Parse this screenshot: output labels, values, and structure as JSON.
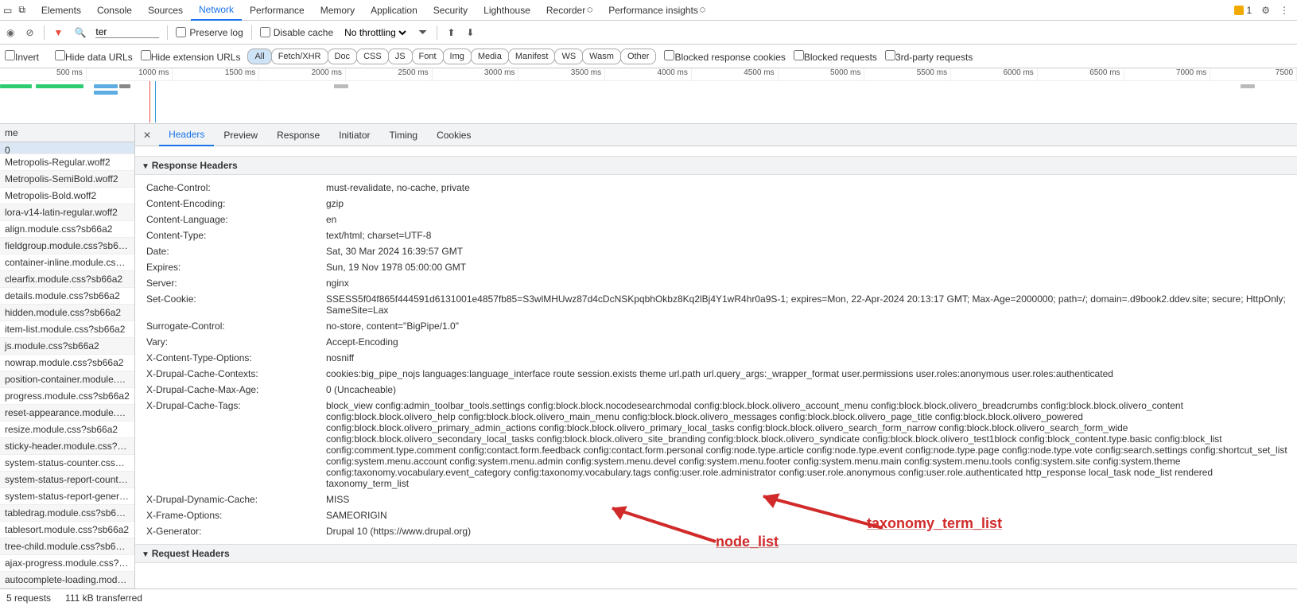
{
  "top_tabs": {
    "items": [
      "Elements",
      "Console",
      "Sources",
      "Network",
      "Performance",
      "Memory",
      "Application",
      "Security",
      "Lighthouse",
      "Recorder",
      "Performance insights"
    ],
    "active_index": 3,
    "beta_indices": [
      9,
      10
    ],
    "warnings": "1"
  },
  "toolbar": {
    "preserve_log": "Preserve log",
    "disable_cache": "Disable cache",
    "throttling": "No throttling",
    "filter_placeholder": "ter"
  },
  "filters2": {
    "invert": "Invert",
    "hide_data": "Hide data URLs",
    "hide_ext": "Hide extension URLs",
    "types": [
      "All",
      "Fetch/XHR",
      "Doc",
      "CSS",
      "JS",
      "Font",
      "Img",
      "Media",
      "Manifest",
      "WS",
      "Wasm",
      "Other"
    ],
    "active_type": 0,
    "blocked_cookies": "Blocked response cookies",
    "blocked_requests": "Blocked requests",
    "third_party": "3rd-party requests"
  },
  "timeline_ticks": [
    "500 ms",
    "1000 ms",
    "1500 ms",
    "2000 ms",
    "2500 ms",
    "3000 ms",
    "3500 ms",
    "4000 ms",
    "4500 ms",
    "5000 ms",
    "5500 ms",
    "6000 ms",
    "6500 ms",
    "7000 ms",
    "7500"
  ],
  "left": {
    "head": "me",
    "selected": "0",
    "rows": [
      "Metropolis-Regular.woff2",
      "Metropolis-SemiBold.woff2",
      "Metropolis-Bold.woff2",
      "lora-v14-latin-regular.woff2",
      "align.module.css?sb66a2",
      "fieldgroup.module.css?sb66…",
      "container-inline.module.css?…",
      "clearfix.module.css?sb66a2",
      "details.module.css?sb66a2",
      "hidden.module.css?sb66a2",
      "item-list.module.css?sb66a2",
      "js.module.css?sb66a2",
      "nowrap.module.css?sb66a2",
      "position-container.module.c…",
      "progress.module.css?sb66a2",
      "reset-appearance.module.cs…",
      "resize.module.css?sb66a2",
      "sticky-header.module.css?s…",
      "system-status-counter.css?…",
      "system-status-report-count…",
      "system-status-report-gener…",
      "tabledrag.module.css?sb66a2",
      "tablesort.module.css?sb66a2",
      "tree-child.module.css?sb66…",
      "ajax-progress.module.css?s…",
      "autocomplete-loading.modu…"
    ]
  },
  "subtabs": {
    "items": [
      "Headers",
      "Preview",
      "Response",
      "Initiator",
      "Timing",
      "Cookies"
    ],
    "active_index": 0
  },
  "response_headers_title": "Response Headers",
  "request_headers_title": "Request Headers",
  "headers": [
    {
      "k": "Cache-Control:",
      "v": "must-revalidate, no-cache, private"
    },
    {
      "k": "Content-Encoding:",
      "v": "gzip"
    },
    {
      "k": "Content-Language:",
      "v": "en"
    },
    {
      "k": "Content-Type:",
      "v": "text/html; charset=UTF-8"
    },
    {
      "k": "Date:",
      "v": "Sat, 30 Mar 2024 16:39:57 GMT"
    },
    {
      "k": "Expires:",
      "v": "Sun, 19 Nov 1978 05:00:00 GMT"
    },
    {
      "k": "Server:",
      "v": "nginx"
    },
    {
      "k": "Set-Cookie:",
      "v": "SSESS5f04f865f444591d6131001e4857fb85=S3wlMHUwz87d4cDcNSKpqbhOkbz8Kq2lBj4Y1wR4hr0a9S-1; expires=Mon, 22-Apr-2024 20:13:17 GMT; Max-Age=2000000; path=/; domain=.d9book2.ddev.site; secure; HttpOnly; SameSite=Lax"
    },
    {
      "k": "Surrogate-Control:",
      "v": "no-store, content=\"BigPipe/1.0\""
    },
    {
      "k": "Vary:",
      "v": "Accept-Encoding"
    },
    {
      "k": "X-Content-Type-Options:",
      "v": "nosniff"
    },
    {
      "k": "X-Drupal-Cache-Contexts:",
      "v": "cookies:big_pipe_nojs languages:language_interface route session.exists theme url.path url.query_args:_wrapper_format user.permissions user.roles:anonymous user.roles:authenticated"
    },
    {
      "k": "X-Drupal-Cache-Max-Age:",
      "v": "0 (Uncacheable)"
    },
    {
      "k": "X-Drupal-Cache-Tags:",
      "v": "block_view config:admin_toolbar_tools.settings config:block.block.nocodesearchmodal config:block.block.olivero_account_menu config:block.block.olivero_breadcrumbs config:block.block.olivero_content config:block.block.olivero_help config:block.block.olivero_main_menu config:block.block.olivero_messages config:block.block.olivero_page_title config:block.block.olivero_powered config:block.block.olivero_primary_admin_actions config:block.block.olivero_primary_local_tasks config:block.block.olivero_search_form_narrow config:block.block.olivero_search_form_wide config:block.block.olivero_secondary_local_tasks config:block.block.olivero_site_branding config:block.block.olivero_syndicate config:block.block.olivero_test1block config:block_content.type.basic config:block_list config:comment.type.comment config:contact.form.feedback config:contact.form.personal config:node.type.article config:node.type.event config:node.type.page config:node.type.vote config:search.settings config:shortcut_set_list config:system.menu.account config:system.menu.admin config:system.menu.devel config:system.menu.footer config:system.menu.main config:system.menu.tools config:system.site config:system.theme config:taxonomy.vocabulary.event_category config:taxonomy.vocabulary.tags config:user.role.administrator config:user.role.anonymous config:user.role.authenticated http_response local_task node_list rendered taxonomy_term_list"
    },
    {
      "k": "X-Drupal-Dynamic-Cache:",
      "v": "MISS"
    },
    {
      "k": "X-Frame-Options:",
      "v": "SAMEORIGIN"
    },
    {
      "k": "X-Generator:",
      "v": "Drupal 10 (https://www.drupal.org)"
    }
  ],
  "status": {
    "requests": "5 requests",
    "transferred": "111 kB transferred"
  },
  "annotations": {
    "node_list": "node_list",
    "tax": "taxonomy_term_list"
  }
}
